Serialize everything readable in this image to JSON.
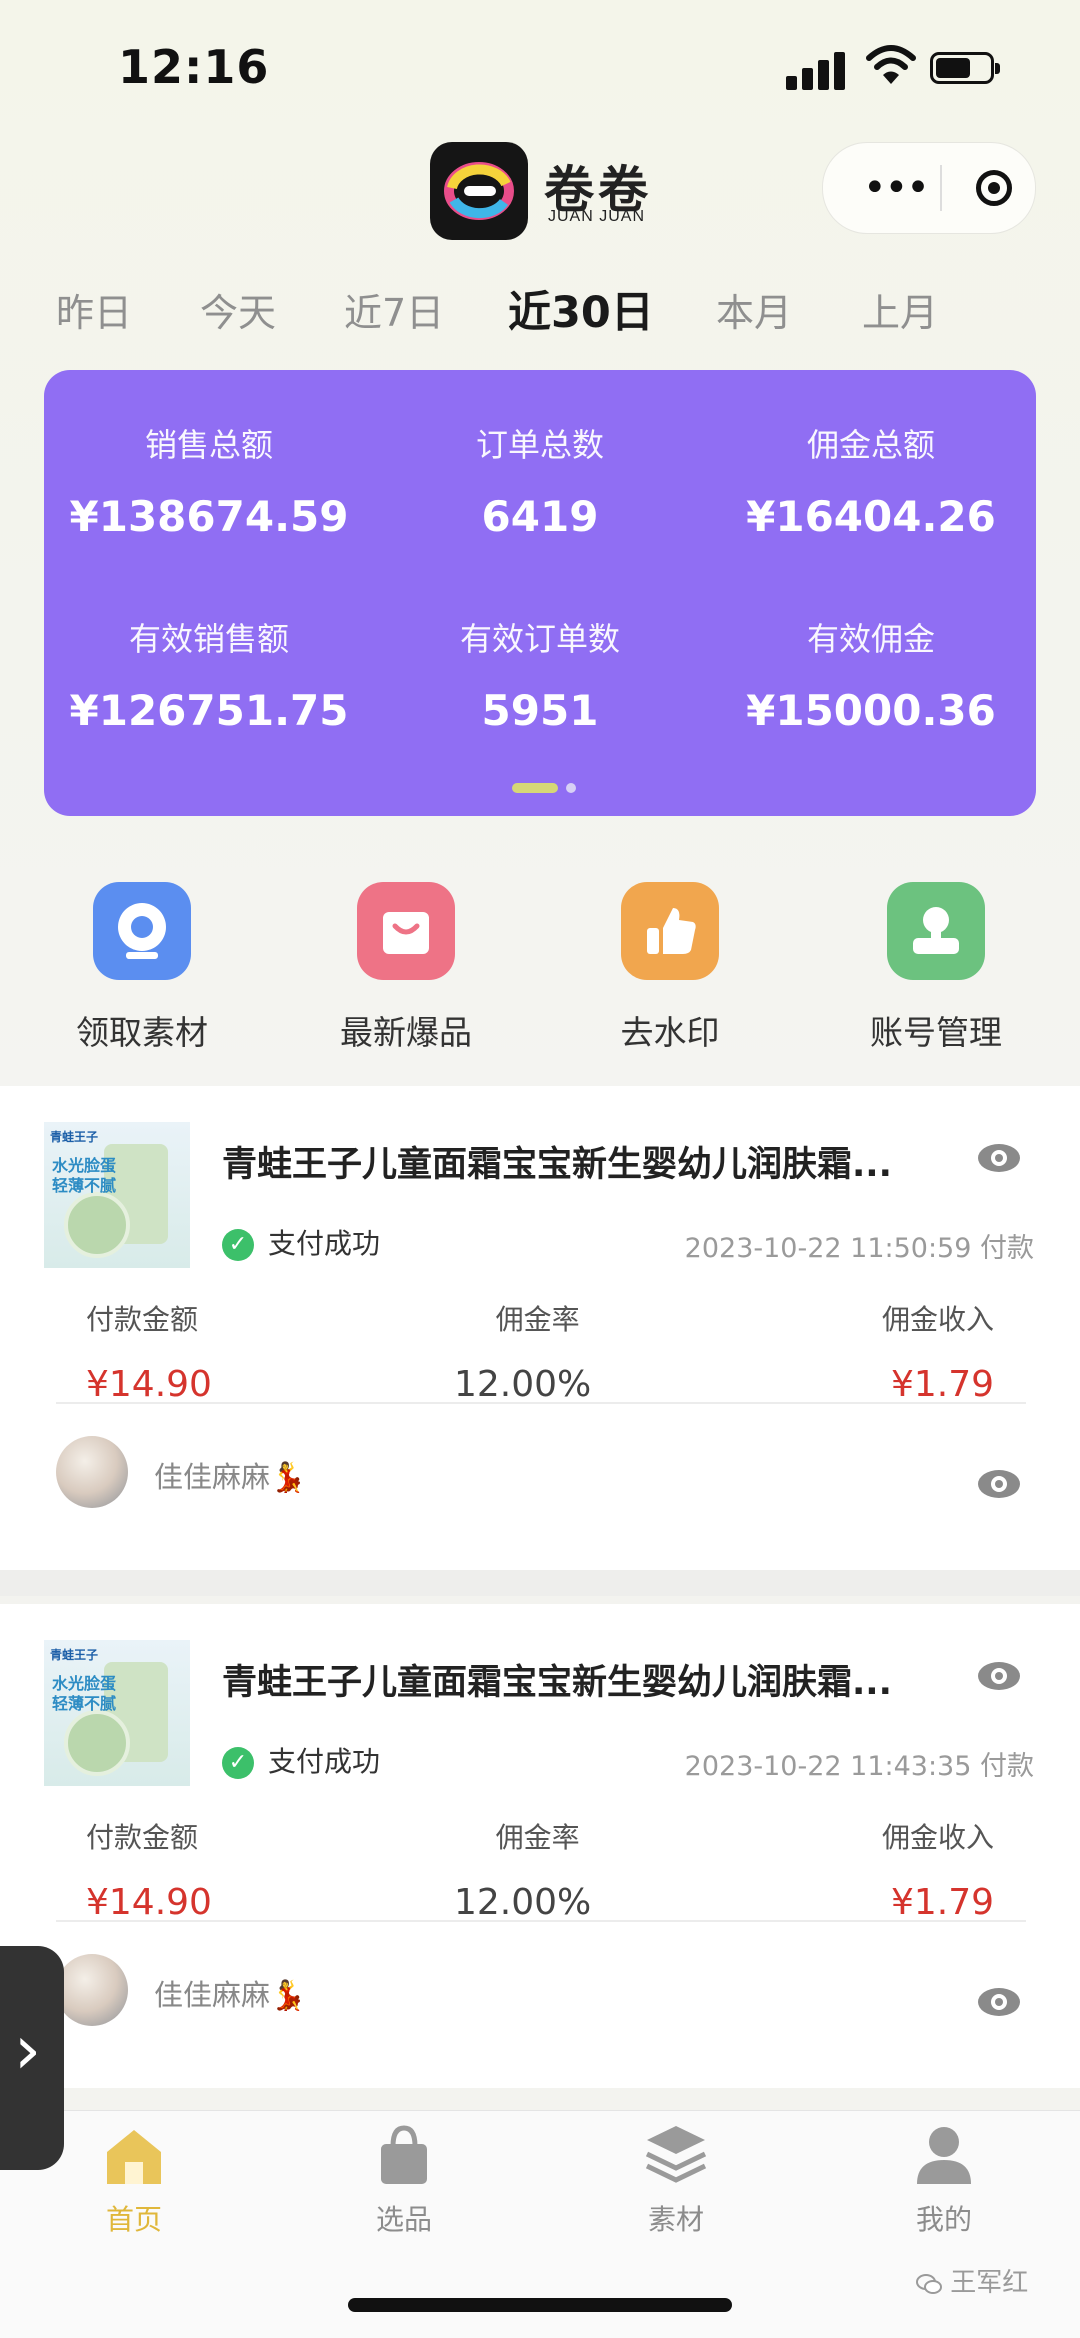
{
  "status_bar": {
    "time": "12:16"
  },
  "header": {
    "app_name": "卷卷",
    "app_sub": "JUAN JUAN"
  },
  "date_tabs": [
    "昨日",
    "今天",
    "近7日",
    "近30日",
    "本月",
    "上月"
  ],
  "date_tab_active": "近30日",
  "stats": {
    "sales_total_label": "销售总额",
    "sales_total": "¥138674.59",
    "orders_total_label": "订单总数",
    "orders_total": "6419",
    "commission_total_label": "佣金总额",
    "commission_total": "¥16404.26",
    "valid_sales_label": "有效销售额",
    "valid_sales": "¥126751.75",
    "valid_orders_label": "有效订单数",
    "valid_orders": "5951",
    "valid_commission_label": "有效佣金",
    "valid_commission": "¥15000.36"
  },
  "actions": [
    {
      "label": "领取素材",
      "icon": "camera-icon",
      "color": "#5b8ef0"
    },
    {
      "label": "最新爆品",
      "icon": "shopping-bag-icon",
      "color": "#ee7386"
    },
    {
      "label": "去水印",
      "icon": "thumbs-up-icon",
      "color": "#f1a64e"
    },
    {
      "label": "账号管理",
      "icon": "user-stamp-icon",
      "color": "#6cc27f"
    }
  ],
  "orders": [
    {
      "thumb_brand": "青蛙王子",
      "thumb_text1": "水光脸蛋",
      "thumb_text2": "轻薄不腻",
      "title": "青蛙王子儿童面霜宝宝新生婴幼儿润肤霜...",
      "status": "支付成功",
      "time": "2023-10-22 11:50:59 付款",
      "pay_label": "付款金额",
      "pay_value": "¥14.90",
      "rate_label": "佣金率",
      "rate_value": "12.00%",
      "income_label": "佣金收入",
      "income_value": "¥1.79",
      "user": "佳佳麻麻💃"
    },
    {
      "thumb_brand": "青蛙王子",
      "thumb_text1": "水光脸蛋",
      "thumb_text2": "轻薄不腻",
      "title": "青蛙王子儿童面霜宝宝新生婴幼儿润肤霜...",
      "status": "支付成功",
      "time": "2023-10-22 11:43:35 付款",
      "pay_label": "付款金额",
      "pay_value": "¥14.90",
      "rate_label": "佣金率",
      "rate_value": "12.00%",
      "income_label": "佣金收入",
      "income_value": "¥1.79",
      "user": "佳佳麻麻💃"
    }
  ],
  "tabbar": [
    {
      "label": "首页",
      "icon": "home-icon",
      "active": true
    },
    {
      "label": "选品",
      "icon": "shopping-bag-icon"
    },
    {
      "label": "素材",
      "icon": "layers-icon"
    },
    {
      "label": "我的",
      "icon": "user-icon"
    }
  ],
  "watermark": "王军红",
  "colors": {
    "stats_card": "#906ef3",
    "accent_red": "#d5342d",
    "tab_active": "#e0b73a"
  }
}
